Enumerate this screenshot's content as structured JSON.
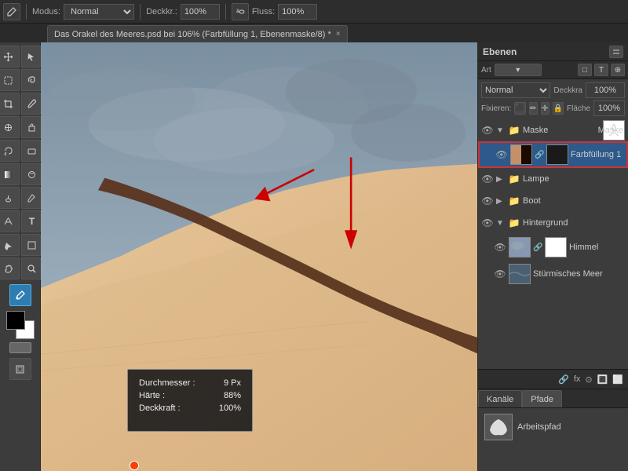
{
  "toolbar": {
    "brush_icon": "✏",
    "mode_label": "Modus:",
    "mode_value": "Normal",
    "opacity_label": "Deckkr.:",
    "opacity_value": "100%",
    "flow_label": "Fluss:",
    "flow_value": "100%",
    "brush_size": "9",
    "airbrush_icon": "💨"
  },
  "tab": {
    "title": "Das Orakel des Meeres.psd bei 106% (Farbfüllung 1, Ebenenmaske/8) *",
    "close": "×"
  },
  "brush_tooltip": {
    "diameter_label": "Durchmesser :",
    "diameter_value": "9 Px",
    "hardness_label": "Härte :",
    "hardness_value": "88%",
    "opacity_label": "Deckkraft :",
    "opacity_value": "100%"
  },
  "layers_panel": {
    "title": "Ebenen",
    "mode_label": "Normal",
    "opacity_label": "Deckkra",
    "fix_label": "Fixieren:",
    "fill_label": "Fläche",
    "layers": [
      {
        "id": "maske-group",
        "type": "group",
        "name": "Maske",
        "expanded": true,
        "visible": true,
        "children": [
          {
            "id": "farbfullung",
            "type": "layer-with-mask",
            "name": "Farbfüllung 1",
            "visible": true,
            "selected": true,
            "has_link": true
          }
        ]
      },
      {
        "id": "lampe",
        "type": "group",
        "name": "Lampe",
        "expanded": false,
        "visible": true
      },
      {
        "id": "boot",
        "type": "group",
        "name": "Boot",
        "expanded": false,
        "visible": true
      },
      {
        "id": "hintergrund-group",
        "type": "group",
        "name": "Hintergrund",
        "expanded": true,
        "visible": true,
        "children": [
          {
            "id": "himmel",
            "type": "layer",
            "name": "Himmel",
            "visible": true
          },
          {
            "id": "meer",
            "type": "layer",
            "name": "Stürmisches Meer",
            "visible": true
          }
        ]
      }
    ]
  },
  "bottom_tabs": {
    "channels": "Kanäle",
    "paths": "Pfade"
  },
  "fx_row": {
    "link_icon": "🔗",
    "fx_label": "fx",
    "circle_icon": "⊙",
    "trash_icon": "🔳"
  },
  "paths_panel": {
    "path_name": "Arbeitspfad"
  }
}
